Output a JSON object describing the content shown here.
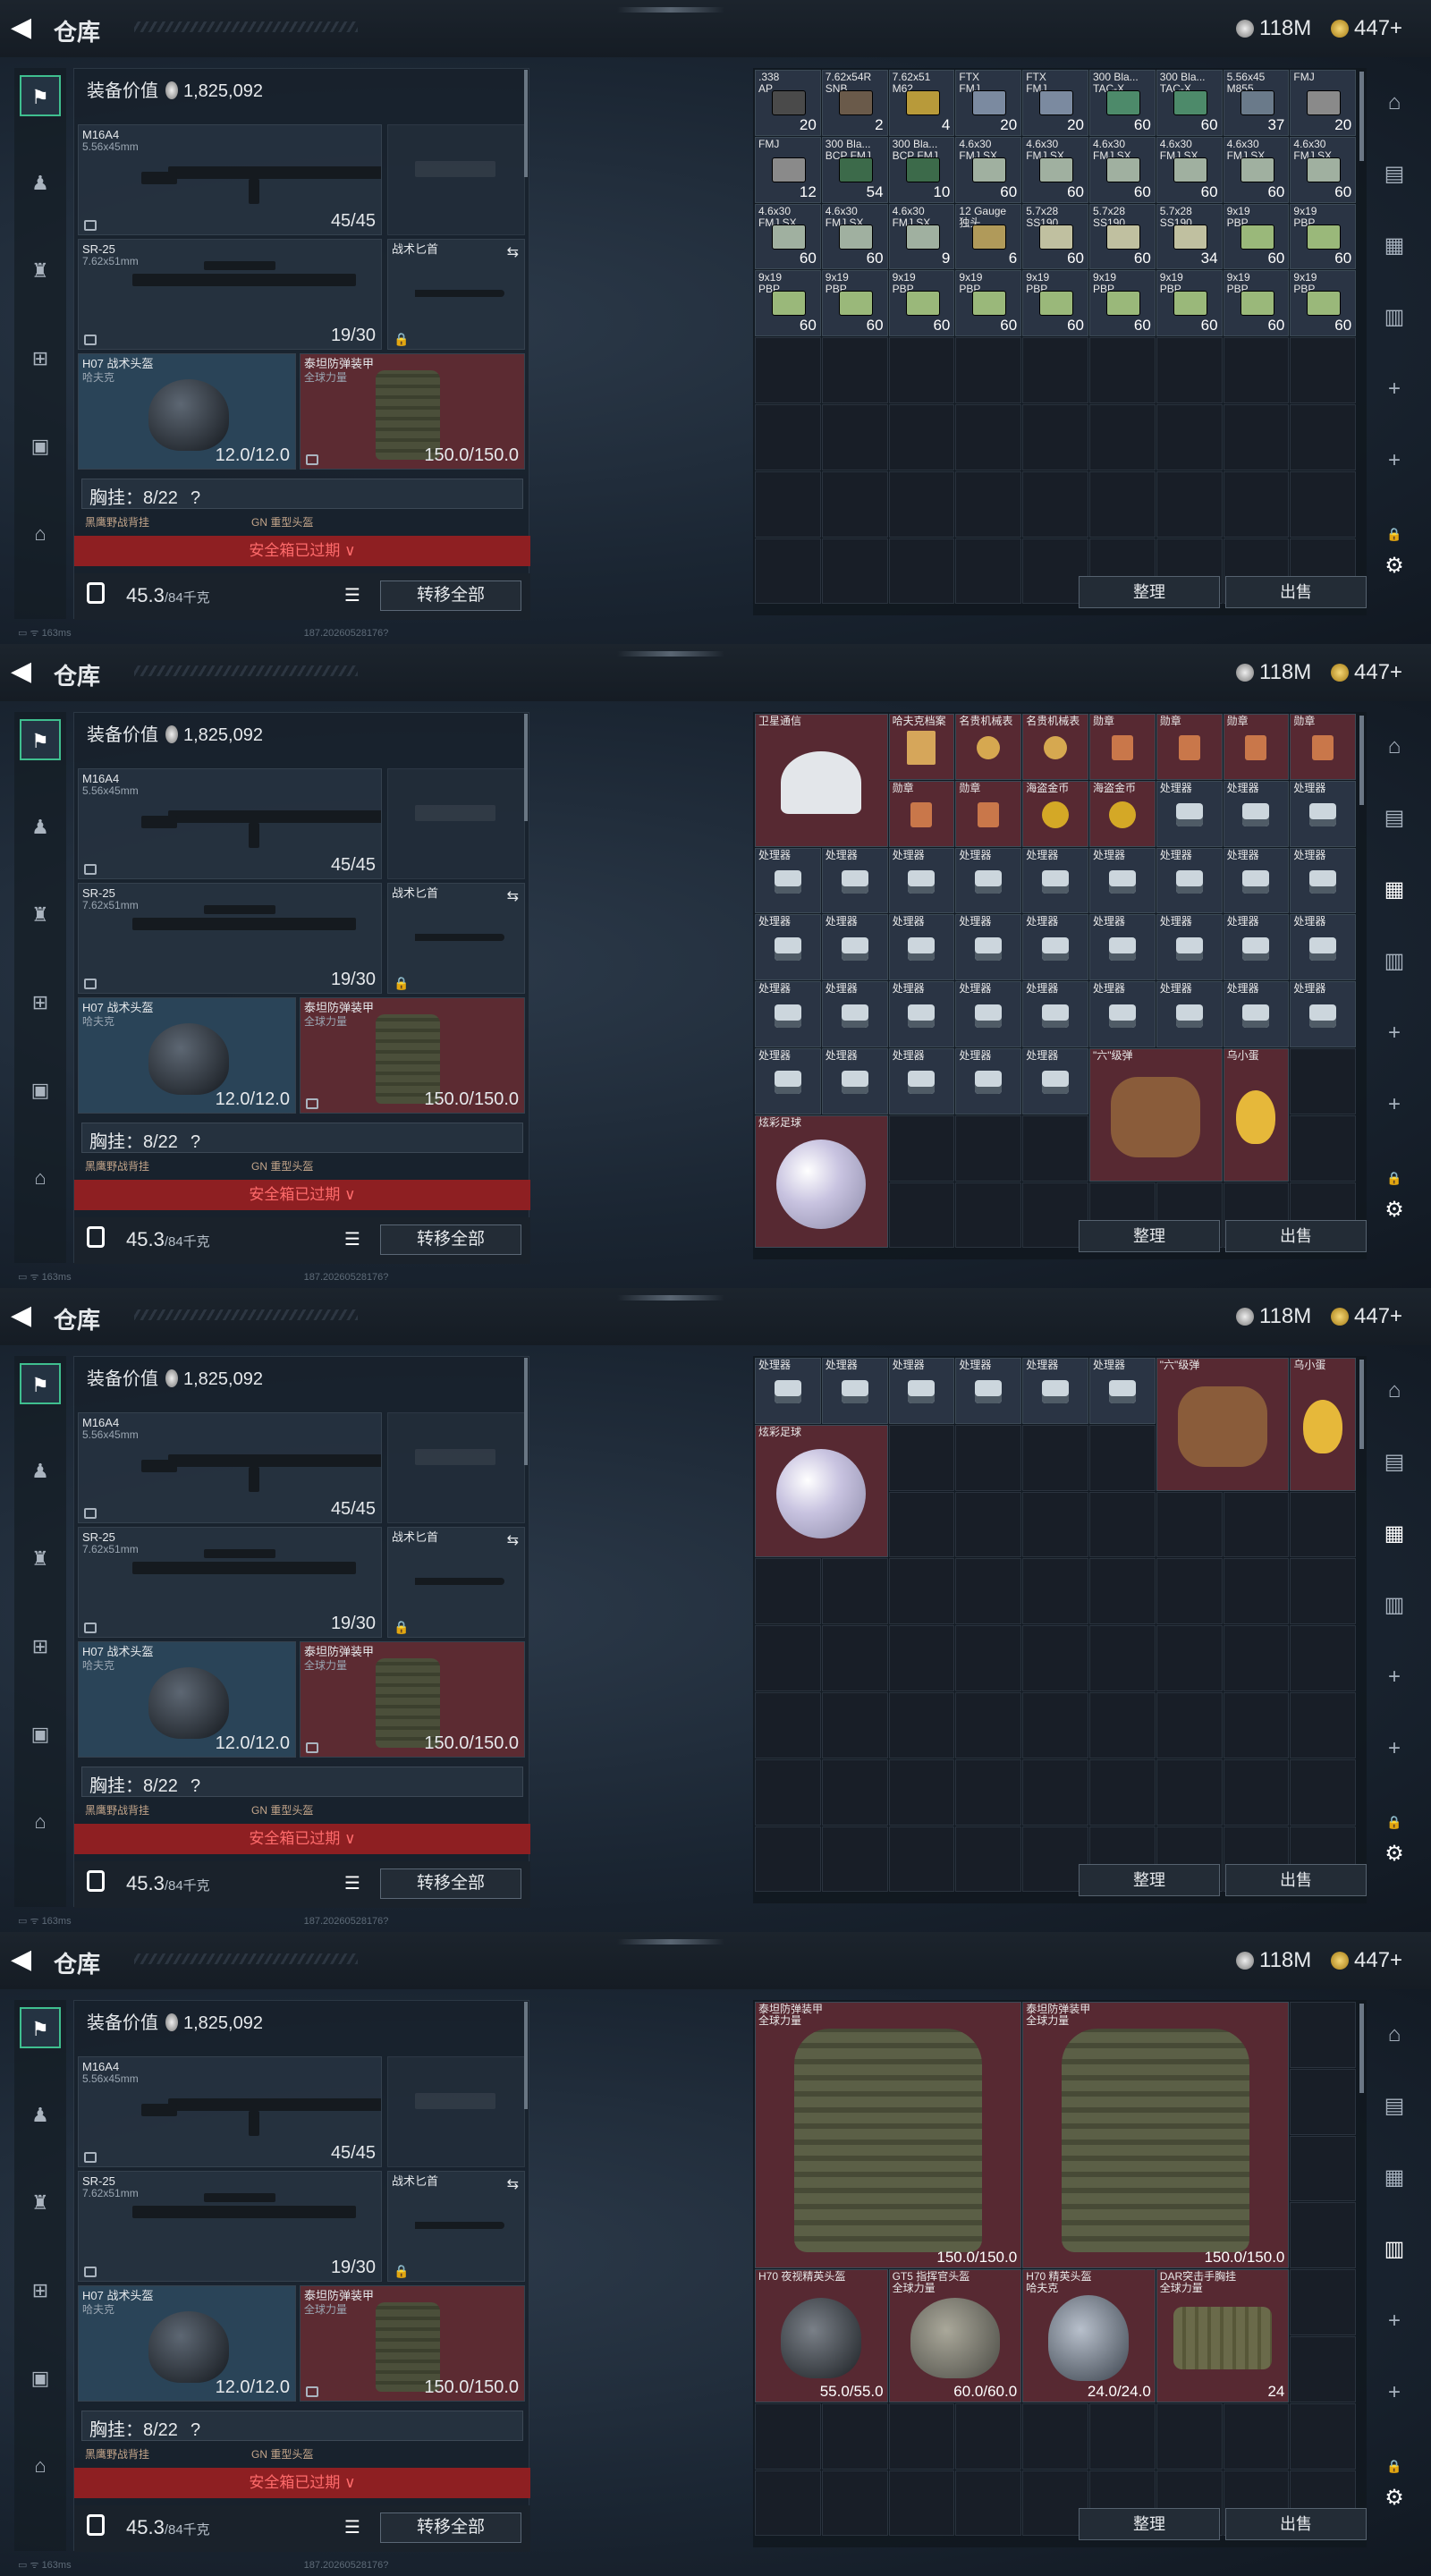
{
  "header": {
    "back_icon": "back-arrow-icon",
    "title": "仓库",
    "silver": "118M",
    "gold": "447+"
  },
  "loadout": {
    "equip_value_label": "装备价值",
    "equip_value": "1,825,092",
    "primary": {
      "name": "M16A4",
      "caliber": "5.56x45mm",
      "ammo": "45/45"
    },
    "secondary": {
      "name": "SR-25",
      "caliber": "7.62x51mm",
      "ammo": "19/30"
    },
    "knife": {
      "name": "战术匕首"
    },
    "helmet": {
      "name": "H07 战术头盔",
      "brand": "哈夫克",
      "durability": "12.0/12.0"
    },
    "armor": {
      "name": "泰坦防弹装甲",
      "brand": "全球力量",
      "durability": "150.0/150.0"
    },
    "chest": {
      "label": "胸挂：",
      "value": "8/22",
      "help": "?"
    },
    "peek_left": "黑鹰野战背挂",
    "peek_right": "GN 重型头盔",
    "expired": "安全箱已过期 ∨",
    "weight": "45.3",
    "weight_unit": "/84千克",
    "transfer_all": "转移全部"
  },
  "stash_buttons": {
    "organize": "整理",
    "sell": "出售"
  },
  "footers": [
    "163ms",
    "187.20260528175?",
    "187.20260528175?",
    "187.20260528175?"
  ],
  "footer_ids": [
    "187.20260528176?",
    "187.20260528176?",
    "187.20260528176?",
    "187.20260528176?"
  ],
  "screens": [
    {
      "items": [
        {
          "n": ".338\nAP",
          "q": "20",
          "c": "#4a4a4a"
        },
        {
          "n": "7.62x54R\nSNB",
          "q": "2",
          "c": "#6a5a4a"
        },
        {
          "n": "7.62x51\nM62",
          "q": "4",
          "c": "#b89a3a"
        },
        {
          "n": "FTX\nFMJ",
          "q": "20",
          "c": "#7b8aa0"
        },
        {
          "n": "FTX\nFMJ",
          "q": "20",
          "c": "#7b8aa0"
        },
        {
          "n": "300 Bla...\nTAC-X",
          "q": "60",
          "c": "#4d8a6a"
        },
        {
          "n": "300 Bla...\nTAC-X",
          "q": "60",
          "c": "#4d8a6a"
        },
        {
          "n": "5.56x45\nM855",
          "q": "37",
          "c": "#6a7a8a"
        },
        {
          "n": "FMJ\n",
          "q": "20",
          "c": "#8a8a8a"
        },
        {
          "n": "FMJ\n",
          "q": "12",
          "c": "#8a8a8a"
        },
        {
          "n": "300 Bla...\nBCP FMJ",
          "q": "54",
          "c": "#3c6a4a"
        },
        {
          "n": "300 Bla...\nBCP FMJ",
          "q": "10",
          "c": "#3c6a4a"
        },
        {
          "n": "4.6x30\nFMJ SX",
          "q": "60",
          "c": "#a0b0a0"
        },
        {
          "n": "4.6x30\nFMJ SX",
          "q": "60",
          "c": "#a0b0a0"
        },
        {
          "n": "4.6x30\nFMJ SX",
          "q": "60",
          "c": "#a0b0a0"
        },
        {
          "n": "4.6x30\nFMJ SX",
          "q": "60",
          "c": "#a0b0a0"
        },
        {
          "n": "4.6x30\nFMJ SX",
          "q": "60",
          "c": "#a0b0a0"
        },
        {
          "n": "4.6x30\nFMJ SX",
          "q": "60",
          "c": "#a0b0a0"
        },
        {
          "n": "4.6x30\nFMJ SX",
          "q": "60",
          "c": "#a0b0a0"
        },
        {
          "n": "4.6x30\nFMJ SX",
          "q": "60",
          "c": "#a0b0a0"
        },
        {
          "n": "4.6x30\nFMJ SX",
          "q": "9",
          "c": "#a0b0a0"
        },
        {
          "n": "12 Gauge\n独头",
          "q": "6",
          "c": "#b09a5a"
        },
        {
          "n": "5.7x28\nSS190",
          "q": "60",
          "c": "#c0c0a0"
        },
        {
          "n": "5.7x28\nSS190",
          "q": "60",
          "c": "#c0c0a0"
        },
        {
          "n": "5.7x28\nSS190",
          "q": "34",
          "c": "#c0c0a0"
        },
        {
          "n": "9x19\nPBP",
          "q": "60",
          "c": "#9ab87a"
        },
        {
          "n": "9x19\nPBP",
          "q": "60",
          "c": "#9ab87a"
        },
        {
          "n": "9x19\nPBP",
          "q": "60",
          "c": "#9ab87a"
        },
        {
          "n": "9x19\nPBP",
          "q": "60",
          "c": "#9ab87a"
        },
        {
          "n": "9x19\nPBP",
          "q": "60",
          "c": "#9ab87a"
        },
        {
          "n": "9x19\nPBP",
          "q": "60",
          "c": "#9ab87a"
        },
        {
          "n": "9x19\nPBP",
          "q": "60",
          "c": "#9ab87a"
        },
        {
          "n": "9x19\nPBP",
          "q": "60",
          "c": "#9ab87a"
        },
        {
          "n": "9x19\nPBP",
          "q": "60",
          "c": "#9ab87a"
        },
        {
          "n": "9x19\nPBP",
          "q": "60",
          "c": "#9ab87a"
        },
        {
          "n": "9x19\nPBP",
          "q": "60",
          "c": "#9ab87a"
        }
      ]
    },
    {
      "items": [
        {
          "n": "卫星通信",
          "w": 2,
          "h": 2,
          "k": "dish"
        },
        {
          "n": "哈夫克档案",
          "k": "file"
        },
        {
          "n": "名贵机械表",
          "k": "watch"
        },
        {
          "n": "名贵机械表",
          "k": "watch"
        },
        {
          "n": "勋章",
          "k": "medal"
        },
        {
          "n": "勋章",
          "k": "medal"
        },
        {
          "n": "勋章",
          "k": "medal"
        },
        {
          "n": "勋章",
          "k": "medal"
        },
        {
          "n": "勋章",
          "k": "medal"
        },
        {
          "n": "勋章",
          "k": "medal"
        },
        {
          "n": "海盗金币",
          "k": "coin"
        },
        {
          "n": "海盗金币",
          "k": "coin"
        },
        {
          "n": "处理器",
          "k": "cpu"
        },
        {
          "n": "处理器",
          "k": "cpu"
        },
        {
          "n": "处理器",
          "k": "cpu"
        },
        {
          "n": "处理器",
          "k": "cpu"
        },
        {
          "n": "处理器",
          "k": "cpu"
        },
        {
          "n": "处理器",
          "k": "cpu"
        },
        {
          "n": "处理器",
          "k": "cpu"
        },
        {
          "n": "处理器",
          "k": "cpu"
        },
        {
          "n": "处理器",
          "k": "cpu"
        },
        {
          "n": "处理器",
          "k": "cpu"
        },
        {
          "n": "处理器",
          "k": "cpu"
        },
        {
          "n": "处理器",
          "k": "cpu"
        },
        {
          "n": "处理器",
          "k": "cpu"
        },
        {
          "n": "处理器",
          "k": "cpu"
        },
        {
          "n": "处理器",
          "k": "cpu"
        },
        {
          "n": "处理器",
          "k": "cpu"
        },
        {
          "n": "处理器",
          "k": "cpu"
        },
        {
          "n": "处理器",
          "k": "cpu"
        },
        {
          "n": "处理器",
          "k": "cpu"
        },
        {
          "n": "处理器",
          "k": "cpu"
        },
        {
          "n": "处理器",
          "k": "cpu"
        },
        {
          "n": "处理器",
          "k": "cpu"
        },
        {
          "n": "处理器",
          "k": "cpu"
        },
        {
          "n": "处理器",
          "k": "cpu"
        },
        {
          "n": "处理器",
          "k": "cpu"
        },
        {
          "n": "处理器",
          "k": "cpu"
        },
        {
          "n": "处理器",
          "k": "cpu"
        },
        {
          "n": "处理器",
          "k": "cpu"
        },
        {
          "n": "处理器",
          "k": "cpu"
        },
        {
          "n": "处理器",
          "k": "cpu"
        },
        {
          "n": "处理器",
          "k": "cpu"
        },
        {
          "n": "处理器",
          "k": "cpu"
        },
        {
          "n": "处理器",
          "k": "cpu"
        },
        {
          "n": "处理器",
          "k": "cpu"
        },
        {
          "n": "处理器",
          "k": "cpu"
        },
        {
          "n": "\"六\"级弹",
          "w": 2,
          "h": 2,
          "k": "glove"
        },
        {
          "n": "乌小蛋",
          "h": 2,
          "k": "egg"
        },
        {
          "n": "炫彩足球",
          "w": 2,
          "h": 2,
          "k": "ball"
        }
      ]
    },
    {
      "items": [
        {
          "n": "处理器",
          "k": "cpu"
        },
        {
          "n": "处理器",
          "k": "cpu"
        },
        {
          "n": "处理器",
          "k": "cpu"
        },
        {
          "n": "处理器",
          "k": "cpu"
        },
        {
          "n": "处理器",
          "k": "cpu"
        },
        {
          "n": "处理器",
          "k": "cpu"
        },
        {
          "n": "\"六\"级弹",
          "w": 2,
          "h": 2,
          "k": "glove"
        },
        {
          "n": "乌小蛋",
          "h": 2,
          "k": "egg"
        },
        {
          "n": "炫彩足球",
          "w": 2,
          "h": 2,
          "k": "ball"
        }
      ]
    },
    {
      "items": [
        {
          "n": "泰坦防弹装甲\n全球力量",
          "w": 4,
          "h": 4,
          "k": "bigvest",
          "q": "150.0/150.0"
        },
        {
          "n": "泰坦防弹装甲\n全球力量",
          "w": 4,
          "h": 4,
          "k": "bigvest",
          "q": "150.0/150.0"
        },
        {
          "n": "H70 夜视精英头盔",
          "w": 2,
          "h": 2,
          "k": "nvg",
          "q": "55.0/55.0"
        },
        {
          "n": "GT5 指挥官头盔\n全球力量",
          "w": 2,
          "h": 2,
          "k": "helmet2",
          "q": "60.0/60.0"
        },
        {
          "n": "H70 精英头盔\n哈夫克",
          "w": 2,
          "h": 2,
          "k": "helmet3",
          "q": "24.0/24.0"
        },
        {
          "n": "DAR突击手胸挂\n全球力量",
          "w": 2,
          "h": 2,
          "k": "rig",
          "q": "24"
        }
      ]
    }
  ],
  "icons": {
    "sidebar": [
      "rifle-icon",
      "vest-icon",
      "backpack-icon",
      "bag-icon",
      "case-icon",
      "briefcase-icon"
    ],
    "rightbar": [
      "home-icon",
      "storage-icon",
      "tag-icon",
      "storage2-icon",
      "plus-icon",
      "plus-icon",
      "lock-icon",
      "gear-icon"
    ]
  }
}
